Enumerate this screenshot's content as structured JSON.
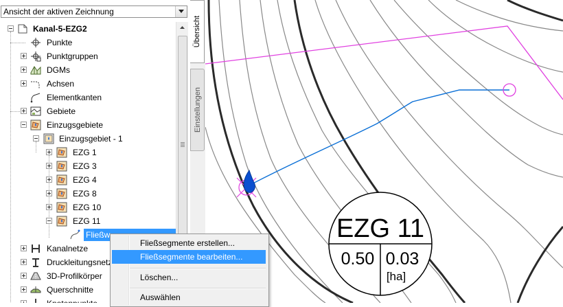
{
  "panel": {
    "view_select": "Ansicht der aktiven Zeichnung",
    "tabs": {
      "overview": "Übersicht",
      "settings": "Einstellungen"
    }
  },
  "tree": {
    "root": "Kanal-5-EZG2",
    "items": {
      "punkte": "Punkte",
      "punktgruppen": "Punktgruppen",
      "dgms": "DGMs",
      "achsen": "Achsen",
      "elementkanten": "Elementkanten",
      "gebiete": "Gebiete",
      "einzugsgebiete": "Einzugsgebiete",
      "einzugsgebiet1": "Einzugsgebiet - 1",
      "ezg1": "EZG 1",
      "ezg3": "EZG 3",
      "ezg4": "EZG 4",
      "ezg8": "EZG 8",
      "ezg10": "EZG 10",
      "ezg11": "EZG 11",
      "fliessweg": "Fließw",
      "kanalnetze": "Kanalnetze",
      "druckleitungsnetze": "Druckleitungsnetz",
      "profilkoerper": "3D-Profilkörper",
      "querschnitte": "Querschnitte",
      "knotenpunkte": "Knotenpunkte"
    }
  },
  "context_menu": {
    "items": [
      "Fließsegmente erstellen...",
      "Fließsegmente bearbeiten...",
      "Löschen...",
      "Auswählen"
    ],
    "highlighted_index": 1
  },
  "drawing": {
    "label": {
      "name": "EZG 11",
      "area": "0.50",
      "coeff": "0.03",
      "unit": "[ha]"
    },
    "colors": {
      "boundary": "#e040e0",
      "flowpath": "#0a6fd6",
      "contour": "#888888",
      "major_contour": "#2a2a2a"
    }
  }
}
